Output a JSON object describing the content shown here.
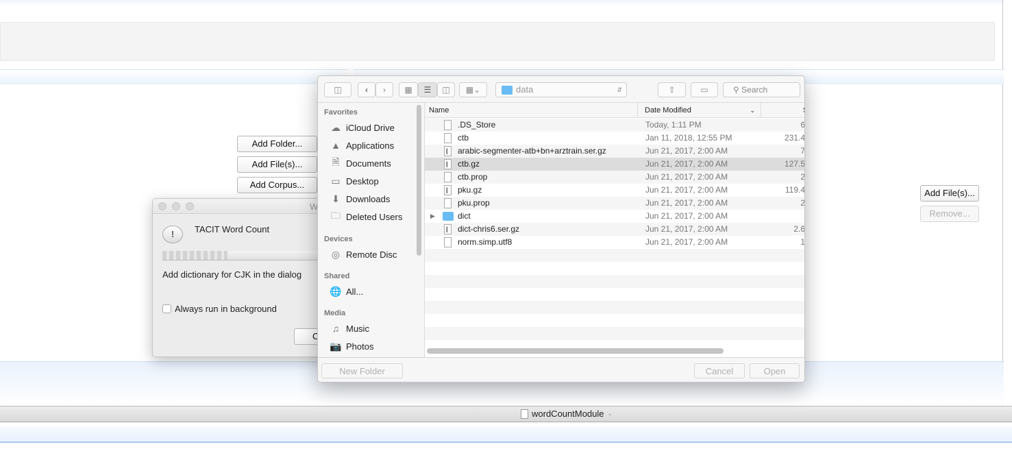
{
  "main": {
    "buttons": {
      "add_folder": "Add Folder...",
      "add_files": "Add File(s)...",
      "add_corpus": "Add Corpus..."
    },
    "right_buttons": {
      "add_files": "Add File(s)...",
      "remove": "Remove..."
    },
    "status_bar": {
      "module": "wordCountModule",
      "icon": "document-icon"
    }
  },
  "progress_dialog": {
    "title_partial": "W",
    "heading": "TACIT Word Count",
    "progress": "indeterminate",
    "message": "Add dictionary for CJK in the dialog",
    "checkbox_label": "Always run in background",
    "checkbox_checked": false,
    "button_partial": "C"
  },
  "file_dialog": {
    "location": "data",
    "search_placeholder": "Search",
    "sidebar": [
      {
        "header": "Favorites",
        "items": [
          {
            "label": "iCloud Drive",
            "icon": "cloud-icon"
          },
          {
            "label": "Applications",
            "icon": "applications-icon"
          },
          {
            "label": "Documents",
            "icon": "documents-icon"
          },
          {
            "label": "Desktop",
            "icon": "desktop-icon"
          },
          {
            "label": "Downloads",
            "icon": "downloads-icon"
          },
          {
            "label": "Deleted Users",
            "icon": "folder-icon"
          }
        ]
      },
      {
        "header": "Devices",
        "items": [
          {
            "label": "Remote Disc",
            "icon": "disc-icon"
          }
        ]
      },
      {
        "header": "Shared",
        "items": [
          {
            "label": "All...",
            "icon": "network-icon"
          }
        ]
      },
      {
        "header": "Media",
        "items": [
          {
            "label": "Music",
            "icon": "music-icon"
          },
          {
            "label": "Photos",
            "icon": "camera-icon"
          }
        ]
      }
    ],
    "columns": {
      "name": "Name",
      "date": "Date Modified",
      "size": "S"
    },
    "files": [
      {
        "name": ".DS_Store",
        "date": "Today, 1:11 PM",
        "size": "6",
        "type": "document"
      },
      {
        "name": "ctb",
        "date": "Jan 11, 2018, 12:55 PM",
        "size": "231.4",
        "type": "document"
      },
      {
        "name": "arabic-segmenter-atb+bn+arztrain.ser.gz",
        "date": "Jun 21, 2017, 2:00 AM",
        "size": "7",
        "type": "archive"
      },
      {
        "name": "ctb.gz",
        "date": "Jun 21, 2017, 2:00 AM",
        "size": "127.5",
        "type": "archive",
        "selected": true
      },
      {
        "name": "ctb.prop",
        "date": "Jun 21, 2017, 2:00 AM",
        "size": "2",
        "type": "document"
      },
      {
        "name": "pku.gz",
        "date": "Jun 21, 2017, 2:00 AM",
        "size": "119.4",
        "type": "archive"
      },
      {
        "name": "pku.prop",
        "date": "Jun 21, 2017, 2:00 AM",
        "size": "2",
        "type": "document"
      },
      {
        "name": "dict",
        "date": "Jun 21, 2017, 2:00 AM",
        "size": "",
        "type": "folder"
      },
      {
        "name": "dict-chris6.ser.gz",
        "date": "Jun 21, 2017, 2:00 AM",
        "size": "2.6",
        "type": "archive"
      },
      {
        "name": "norm.simp.utf8",
        "date": "Jun 21, 2017, 2:00 AM",
        "size": "1",
        "type": "document"
      }
    ],
    "buttons": {
      "new_folder": "New Folder",
      "cancel": "Cancel",
      "open": "Open"
    }
  }
}
